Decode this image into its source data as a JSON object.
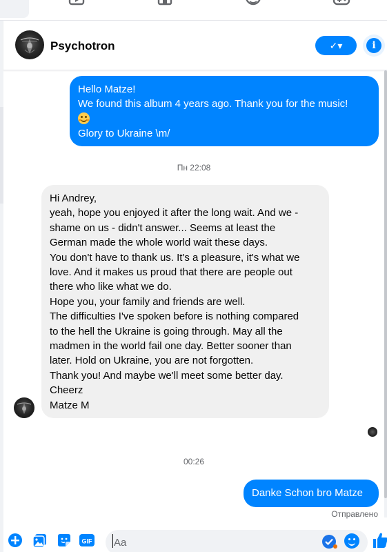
{
  "header": {
    "contact_name": "Psychotron",
    "call_label": "✓▾",
    "info_label": "i"
  },
  "thread": {
    "timestamp_1": "Пн 22:08",
    "timestamp_2": "00:26",
    "messages": [
      {
        "direction": "outgoing",
        "lines": [
          "Hello Matze!",
          "We found this album 4 years ago. Thank you for the music!",
          "EMOJI",
          "Glory to Ukraine \\m/"
        ],
        "emoji_icon": "smiling-face-emoji"
      },
      {
        "direction": "incoming",
        "lines": [
          "Hi Andrey,",
          "yeah, hope you enjoyed it after the long wait. And we -",
          "shame on us - didn't answer... Seems at least the",
          "German made the whole world wait these days.",
          "You don't have to thank us. It's a pleasure, it's what we",
          "love. And it makes us proud that there are people out",
          "there who like what we do.",
          "Hope you, your family and friends are well.",
          "The difficulties I've spoken before is nothing compared",
          "to the hell the Ukraine is going through. May all the",
          "madmen in the world fail one day. Better sooner than",
          "later. Hold on Ukraine, you are not forgotten.",
          "Thank you! And maybe we'll meet some better day.",
          "Cheerz",
          "Matze M"
        ]
      },
      {
        "direction": "outgoing",
        "lines": [
          "Danke Schon bro Matze"
        ]
      }
    ],
    "sent_status": "Отправлено"
  },
  "composer": {
    "placeholder": "Aa",
    "icons": [
      "plus-icon",
      "photo-icon",
      "sticker-icon",
      "gif-icon",
      "grammar-check-icon",
      "emoji-icon",
      "thumbs-up-icon"
    ],
    "gif_label": "GIF"
  },
  "colors": {
    "accent": "#0084ff",
    "incoming_bubble": "#f0f0f0",
    "meta_text": "#65676b"
  }
}
